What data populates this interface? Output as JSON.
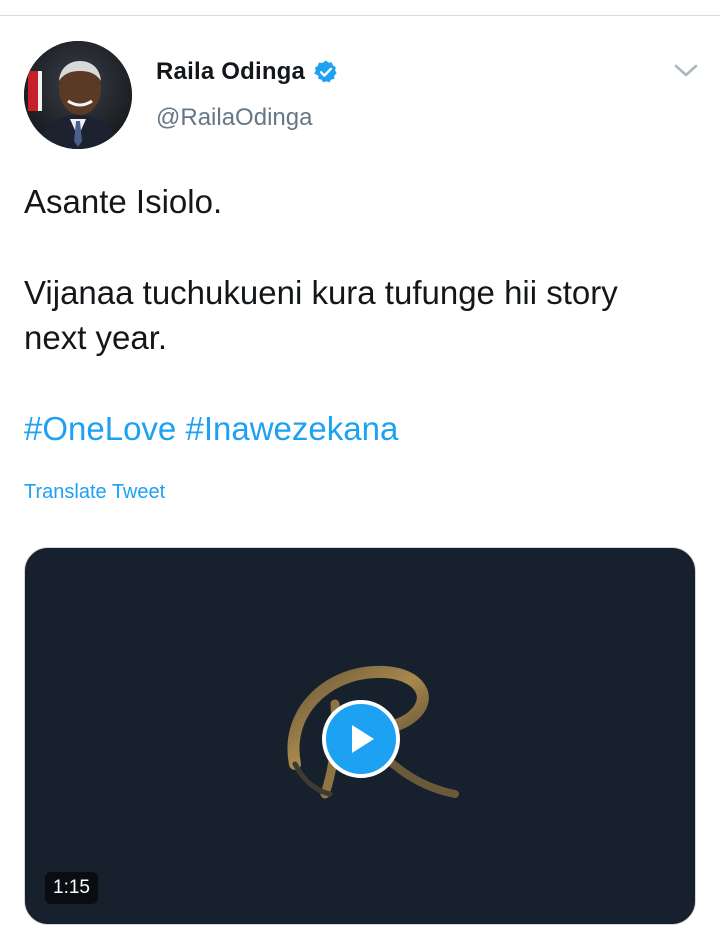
{
  "author": {
    "name": "Raila Odinga",
    "handle": "@RailaOdinga",
    "verified": true,
    "avatar_icon": "profile-photo"
  },
  "tweet": {
    "lines": [
      "Asante Isiolo.",
      "Vijanaa tuchukueni kura tufunge hii story",
      "next year."
    ],
    "hashtags": [
      "#OneLove",
      "#Inawezekana"
    ],
    "translate_label": "Translate Tweet"
  },
  "media": {
    "type": "video",
    "duration": "1:15",
    "play_icon": "play-icon",
    "background_color": "#17212e"
  },
  "colors": {
    "link": "#1da1f2",
    "text": "#14171a",
    "secondary": "#657786"
  }
}
